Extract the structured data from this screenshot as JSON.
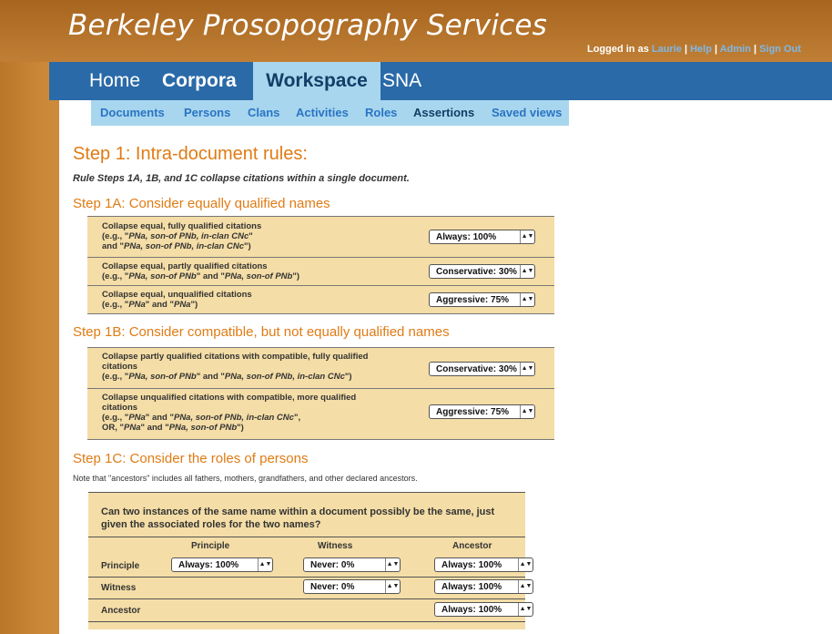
{
  "header": {
    "title": "Berkeley Prosopography Services",
    "login_prefix": "Logged in as",
    "user": "Laurie",
    "help": "Help",
    "admin": "Admin",
    "signout": "Sign Out",
    "sep": "|"
  },
  "nav": {
    "home": "Home",
    "corpora": "Corpora",
    "workspace": "Workspace",
    "sna": "SNA"
  },
  "subnav": {
    "documents": "Documents",
    "persons": "Persons",
    "clans": "Clans",
    "activities": "Activities",
    "roles": "Roles",
    "assertions": "Assertions",
    "saved_views": "Saved views"
  },
  "step1": {
    "title": "Step 1: Intra-document rules:",
    "intro": "Rule Steps 1A, 1B, and 1C collapse citations within a single document."
  },
  "step1a": {
    "title": "Step 1A: Consider equally qualified names",
    "r1": {
      "l1": "Collapse equal, fully qualified citations",
      "l2a": "(e.g., \"",
      "l2b": "PNa, son-of PNb, in-clan CNc",
      "l2c": "\"",
      "l3a": "and \"",
      "l3b": "PNa, son-of PNb, in-clan CNc",
      "l3c": "\")",
      "value": "Always: 100%"
    },
    "r2": {
      "l1": "Collapse equal, partly qualified citations",
      "l2a": "(e.g., \"",
      "l2b": "PNa, son-of PNb",
      "l2c": "\" and \"",
      "l2d": "PNa, son-of PNb",
      "l2e": "\")",
      "value": "Conservative: 30%"
    },
    "r3": {
      "l1": "Collapse equal, unqualified citations",
      "l2a": "(e.g., \"",
      "l2b": "PNa",
      "l2c": "\" and \"",
      "l2d": "PNa",
      "l2e": "\")",
      "value": "Aggressive: 75%"
    }
  },
  "step1b": {
    "title": "Step 1B: Consider compatible, but not equally qualified names",
    "r1": {
      "l1": "Collapse partly qualified citations with compatible, fully qualified",
      "l2": "citations",
      "l3a": "(e.g., \"",
      "l3b": "PNa, son-of PNb",
      "l3c": "\" and \"",
      "l3d": "PNa, son-of PNb, in-clan CNc",
      "l3e": "\")",
      "value": "Conservative: 30%"
    },
    "r2": {
      "l1": "Collapse unqualified citations with compatible, more qualified",
      "l2": "citations",
      "l3a": "(e.g., \"",
      "l3b": "PNa",
      "l3c": "\" and \"",
      "l3d": "PNa, son-of PNb, in-clan CNc",
      "l3e": "\",",
      "l4a": "OR, \"",
      "l4b": "PNa",
      "l4c": "\" and \"",
      "l4d": "PNa, son-of PNb",
      "l4e": "\")",
      "value": "Aggressive: 75%"
    }
  },
  "step1c": {
    "title": "Step 1C: Consider the roles of persons",
    "note": "Note that \"ancestors\" includes all fathers, mothers, grandfathers, and other declared ancestors.",
    "question": "Can two instances of the same name within a document possibly be the same, just given the associated roles for the two names?",
    "cols": [
      "Principle",
      "Witness",
      "Ancestor"
    ],
    "rows": [
      "Principle",
      "Witness",
      "Ancestor"
    ],
    "principle_principle": "Always: 100%",
    "principle_witness": "Never: 0%",
    "principle_ancestor": "Always: 100%",
    "witness_witness": "Never: 0%",
    "witness_ancestor": "Always: 100%",
    "ancestor_ancestor": "Always: 100%"
  },
  "icons": {
    "select_arrow": "up-down-arrows-icon"
  },
  "colors": {
    "heading": "#e07b14",
    "nav_bg": "#2a6aa8",
    "active_tab": "#a8d6ee",
    "table_bg": "#f4dda6",
    "link": "#2a74c4"
  }
}
